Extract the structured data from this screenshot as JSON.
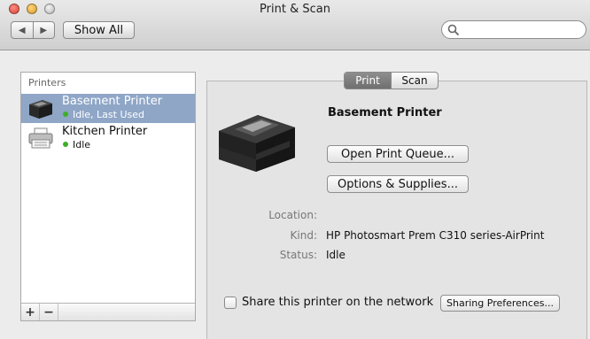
{
  "window": {
    "title": "Print & Scan"
  },
  "toolbar": {
    "back_glyph": "◀",
    "forward_glyph": "▶",
    "show_all_label": "Show All",
    "search_placeholder": ""
  },
  "printers_list": {
    "header": "Printers",
    "items": [
      {
        "name": "Basement Printer",
        "status": "Idle, Last Used",
        "selected": true,
        "icon": "inkjet-printer-icon"
      },
      {
        "name": "Kitchen Printer",
        "status": "Idle",
        "selected": false,
        "icon": "printer-icon"
      }
    ],
    "add_label": "+",
    "remove_label": "−"
  },
  "detail": {
    "tabs": [
      {
        "label": "Print",
        "active": true
      },
      {
        "label": "Scan",
        "active": false
      }
    ],
    "printer_name": "Basement Printer",
    "open_queue_label": "Open Print Queue...",
    "options_label": "Options & Supplies...",
    "fields": [
      {
        "label": "Location:",
        "value": ""
      },
      {
        "label": "Kind:",
        "value": "HP Photosmart Prem C310 series-AirPrint"
      },
      {
        "label": "Status:",
        "value": "Idle"
      }
    ],
    "share_label": "Share this printer on the network",
    "share_checked": false,
    "sharing_prefs_label": "Sharing Preferences..."
  },
  "colors": {
    "selection": "#8fa6c7",
    "status_dot": "#3fae2a"
  }
}
